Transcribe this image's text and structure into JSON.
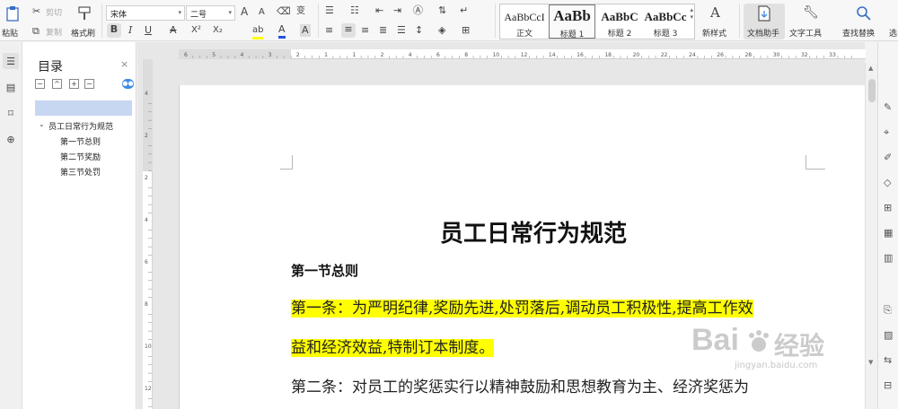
{
  "ribbon": {
    "paste": "粘贴",
    "cut": "剪切",
    "copy": "复制",
    "format_painter": "格式刷",
    "font_name": "宋体",
    "font_size": "二号",
    "bold": "B",
    "italic": "I",
    "underline": "U",
    "strike": "A",
    "superscript": "X²",
    "subscript": "X₂",
    "highlight": "ab",
    "font_color": "A",
    "char_shade": "A",
    "grow_font": "A",
    "shrink_font": "A",
    "phonetic": "变",
    "styles": [
      {
        "sample": "AaBbCcI",
        "name": "正文"
      },
      {
        "sample": "AaBb",
        "name": "标题 1"
      },
      {
        "sample": "AaBbC",
        "name": "标题 2"
      },
      {
        "sample": "AaBbCc",
        "name": "标题 3"
      }
    ],
    "new_style": "新样式",
    "doc_assistant": "文档助手",
    "text_tools": "文字工具",
    "find_replace": "查找替换",
    "select": "选",
    "dropdown_arrow": "▾"
  },
  "outline": {
    "title": "目录",
    "close": "×",
    "btn_collapse": "−",
    "btn_up": "^",
    "btn_add": "+",
    "btn_remove": "−",
    "items": [
      {
        "label": "员工日常行为规范",
        "level": 1,
        "expander": "⌄"
      },
      {
        "label": "第一节总则",
        "level": 2
      },
      {
        "label": "第二节奖励",
        "level": 2
      },
      {
        "label": "第三节处罚",
        "level": 2
      }
    ]
  },
  "document": {
    "title": "员工日常行为规范",
    "section1": "第一节总则",
    "para1_line1": "第一条：为严明纪律,奖励先进,处罚落后,调动员工积极性,提高工作效",
    "para1_line2": "益和经济效益,特制订本制度。",
    "para2_line1": "第二条：对员工的奖惩实行以精神鼓励和思想教育为主、经济奖惩为"
  },
  "ruler": {
    "top_ticks": [
      "6",
      "5",
      "4",
      "3",
      "2",
      "1",
      "1",
      "2",
      "4",
      "6",
      "8",
      "10",
      "12",
      "14",
      "16",
      "18",
      "20",
      "22",
      "24",
      "26",
      "28",
      "30",
      "32",
      "33"
    ],
    "left_ticks": [
      "4",
      "2",
      "2",
      "4",
      "6",
      "8",
      "10",
      "12"
    ]
  },
  "watermark": {
    "text": "Bai",
    "cn": "经验",
    "url": "jingyan.baidu.com"
  },
  "colors": {
    "highlight": "#ffff00",
    "outline_selected": "#c7d6f1",
    "accent_blue": "#3d8be6",
    "font_color_bar": "#2455e0"
  }
}
